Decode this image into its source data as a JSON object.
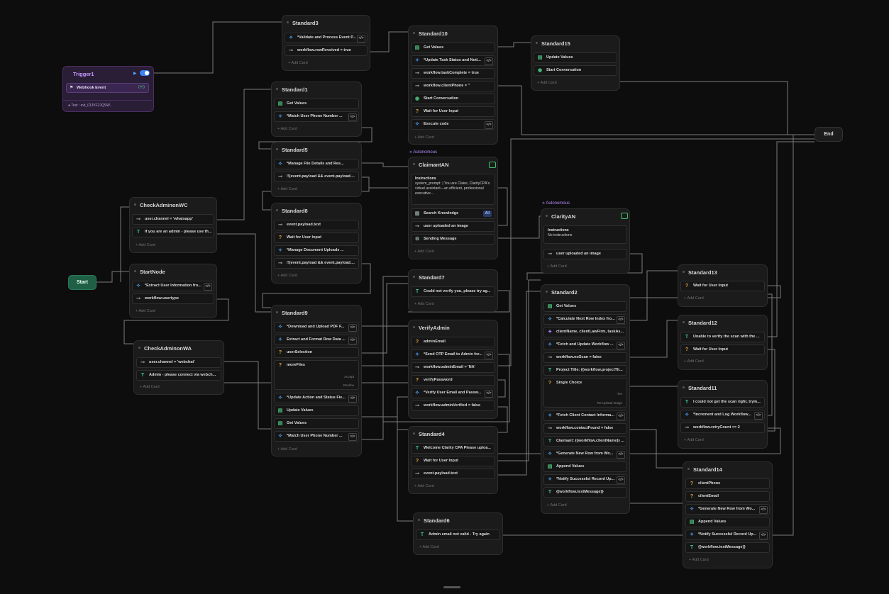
{
  "trigger": {
    "title": "Trigger1",
    "event": "Webhook Event",
    "test": "Test : evt_01JVF2JQSW..."
  },
  "start_label": "Start",
  "end_label": "End",
  "add_card": "Add Card",
  "autonomous": "Autonomous",
  "nodes": {
    "standard3": {
      "title": "Standard3",
      "r0": "*Validate and Process Event P...",
      "r1": "workflow.rowReveived = true"
    },
    "standard10": {
      "title": "Standard10",
      "r0": "Get Values",
      "r1": "*Update Task Status and Noti...",
      "r2": "workflow.taskComplete = true",
      "r3": "workflow.clientPhone = ''",
      "r4": "Start Conversation",
      "r5": "Wait for User Input",
      "r6": "Execute code"
    },
    "standard15": {
      "title": "Standard15",
      "r0": "Update Values",
      "r1": "Start Conversation"
    },
    "standard1": {
      "title": "Standard1",
      "r0": "Get Values",
      "r1": "*Match User Phone Number ..."
    },
    "standard5": {
      "title": "Standard5",
      "r0": "*Manage File Details and Res...",
      "r1": "!!(event.payload && event.payload...."
    },
    "standard8": {
      "title": "Standard8",
      "r0": "event.payload.text",
      "r1": "Wait for User Input",
      "r2": "*Manage Document Uploads ...",
      "r3": "!!(event.payload && event.payload...."
    },
    "claimant": {
      "title": "ClaimantAN",
      "instr_title": "Instructions",
      "instr_body": "system_prompt: | You are Claire, ClarityCPA's virtual assistant—an efficient, professional executive...",
      "r0": "Search Knowledge",
      "r0_badge": "All",
      "r1": "user uploaded an image",
      "r2": "Sending Message"
    },
    "clarity": {
      "title": "ClarityAN",
      "instr_title": "Instructions",
      "instr_body": "No instructions",
      "r0": "user uploaded an image"
    },
    "checkWC": {
      "title": "CheckAdminonWC",
      "r0": "user.channel = 'whatsapp'",
      "r1": "If you are an admin - please use th..."
    },
    "startnode": {
      "title": "StartNode",
      "r0": "*Extract User Information fro...",
      "r1": "workflow.usertype"
    },
    "checkWA": {
      "title": "CheckAdminonWA",
      "r0": "user.channel = 'webchat'",
      "r1": "Admin - please connect via webch..."
    },
    "standard9": {
      "title": "Standard9",
      "r0": "*Download and Upload PDF F...",
      "r1": "Extract and Format Row Data ...",
      "r2": "userSelection",
      "r3": "moreFiles",
      "accept": "Accept",
      "decline": "Decline",
      "r4": "*Update Action and Status Fie...",
      "r5": "Update Values",
      "r6": "Get Values",
      "r7": "*Match User Phone Number ..."
    },
    "standard7": {
      "title": "Standard7",
      "r0": "Could not verify you, please try ag..."
    },
    "verifyadmin": {
      "title": "VerifyAdmin",
      "r0": "adminEmail",
      "r1": "*Send OTP Email to Admin for...",
      "r2": "workflow.adminEmail = 'NA'",
      "r3": "verifyPassword",
      "r4": "*Verify User Email and Passw...",
      "r5": "workflow.adminVerified = false"
    },
    "standard4": {
      "title": "Standard4",
      "r0": "Welcome Clarity CPA Please uploa...",
      "r1": "Wait for User Input",
      "r2": "event.payload.text"
    },
    "standard6": {
      "title": "Standard6",
      "r0": "Admin email not valid - Try again"
    },
    "standard2": {
      "title": "Standard2",
      "r0": "Get Values",
      "r1": "*Calculate Next Row Index fro...",
      "r2": "clientName, clientLawFirm, taskAs...",
      "r3": "*Fetch and Update Workflow ...",
      "r4": "workflow.noScan = false",
      "r5": "Project Title: {{workflow.projectTit...",
      "r6": "Single Choice",
      "yes": "Yes",
      "reupload": "Re-Upload Image",
      "r7": "*Fetch Client Contact Informa...",
      "r8": "workflow.contactFound = false",
      "r9": "Claimant: {{workflow.clientName}} ...",
      "r10": "*Generate New Row from Wo...",
      "r11": "Append Values",
      "r12": "*Notify Successful Record Up...",
      "r13": "{{workflow.textMessage}}"
    },
    "standard13": {
      "title": "Standard13",
      "r0": "Wait for User Input"
    },
    "standard12": {
      "title": "Standard12",
      "r0": "Unable to verify the scan with the ...",
      "r1": "Wait for User Input"
    },
    "standard11": {
      "title": "Standard11",
      "r0": "I could not get the scan right, tryin...",
      "r1": "*Increment and Log Workflow...",
      "r2": "workflow.retryCount <= 2"
    },
    "standard14": {
      "title": "Standard14",
      "r0": "clientPhone",
      "r1": "clientEmail",
      "r2": "*Generate New Row from Wo...",
      "r3": "Append Values",
      "r4": "*Notify Successful Record Up...",
      "r5": "{{workflow.textMessage}}"
    }
  }
}
